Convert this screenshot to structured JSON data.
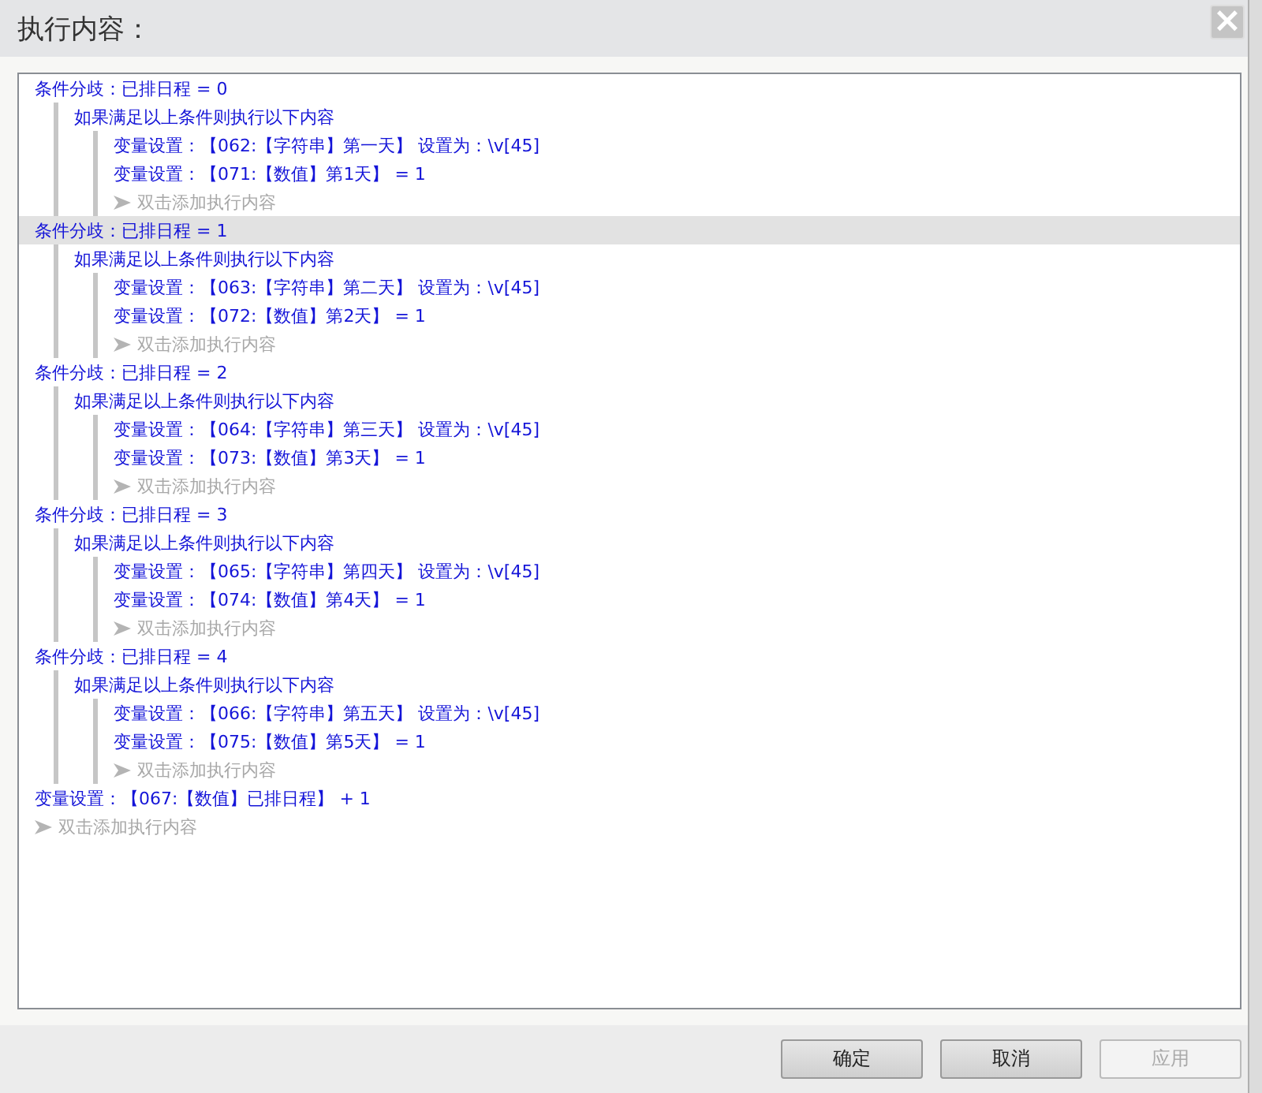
{
  "dialog": {
    "title": "执行内容：",
    "close_label": "×"
  },
  "tree": [
    {
      "kind": "branch",
      "text": "条件分歧：已排日程 = 0",
      "selected": false,
      "children": [
        {
          "kind": "block",
          "text": "如果满足以上条件则执行以下内容",
          "selected": false,
          "children": [
            {
              "kind": "action",
              "text": "变量设置：【062:【字符串】第一天】 设置为：\\v[45]",
              "selected": false
            },
            {
              "kind": "action",
              "text": "变量设置：【071:【数值】第1天】 = 1",
              "selected": false
            },
            {
              "kind": "add",
              "text": "双击添加执行内容",
              "selected": false
            }
          ]
        }
      ]
    },
    {
      "kind": "branch",
      "text": "条件分歧：已排日程 = 1",
      "selected": true,
      "children": [
        {
          "kind": "block",
          "text": "如果满足以上条件则执行以下内容",
          "selected": false,
          "children": [
            {
              "kind": "action",
              "text": "变量设置：【063:【字符串】第二天】 设置为：\\v[45]",
              "selected": false
            },
            {
              "kind": "action",
              "text": "变量设置：【072:【数值】第2天】 = 1",
              "selected": false
            },
            {
              "kind": "add",
              "text": "双击添加执行内容",
              "selected": false
            }
          ]
        }
      ]
    },
    {
      "kind": "branch",
      "text": "条件分歧：已排日程 = 2",
      "selected": false,
      "children": [
        {
          "kind": "block",
          "text": "如果满足以上条件则执行以下内容",
          "selected": false,
          "children": [
            {
              "kind": "action",
              "text": "变量设置：【064:【字符串】第三天】 设置为：\\v[45]",
              "selected": false
            },
            {
              "kind": "action",
              "text": "变量设置：【073:【数值】第3天】 = 1",
              "selected": false
            },
            {
              "kind": "add",
              "text": "双击添加执行内容",
              "selected": false
            }
          ]
        }
      ]
    },
    {
      "kind": "branch",
      "text": "条件分歧：已排日程 = 3",
      "selected": false,
      "children": [
        {
          "kind": "block",
          "text": "如果满足以上条件则执行以下内容",
          "selected": false,
          "children": [
            {
              "kind": "action",
              "text": "变量设置：【065:【字符串】第四天】 设置为：\\v[45]",
              "selected": false
            },
            {
              "kind": "action",
              "text": "变量设置：【074:【数值】第4天】 = 1",
              "selected": false
            },
            {
              "kind": "add",
              "text": "双击添加执行内容",
              "selected": false
            }
          ]
        }
      ]
    },
    {
      "kind": "branch",
      "text": "条件分歧：已排日程 = 4",
      "selected": false,
      "children": [
        {
          "kind": "block",
          "text": "如果满足以上条件则执行以下内容",
          "selected": false,
          "children": [
            {
              "kind": "action",
              "text": "变量设置：【066:【字符串】第五天】 设置为：\\v[45]",
              "selected": false
            },
            {
              "kind": "action",
              "text": "变量设置：【075:【数值】第5天】 = 1",
              "selected": false
            },
            {
              "kind": "add",
              "text": "双击添加执行内容",
              "selected": false
            }
          ]
        }
      ]
    },
    {
      "kind": "action",
      "text": "变量设置：【067:【数值】已排日程】 + 1",
      "selected": false
    },
    {
      "kind": "add",
      "text": "双击添加执行内容",
      "selected": false
    }
  ],
  "buttons": [
    {
      "label": "确定",
      "disabled": false
    },
    {
      "label": "取消",
      "disabled": false
    },
    {
      "label": "应用",
      "disabled": true
    }
  ]
}
